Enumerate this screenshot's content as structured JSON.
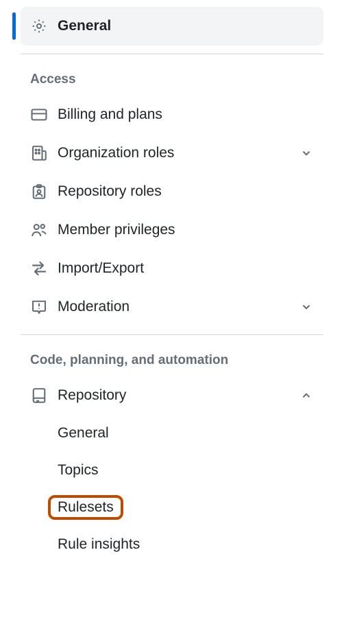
{
  "general": {
    "label": "General"
  },
  "sections": {
    "access": {
      "title": "Access",
      "items": {
        "billing": {
          "label": "Billing and plans"
        },
        "org_roles": {
          "label": "Organization roles"
        },
        "repo_roles": {
          "label": "Repository roles"
        },
        "member_priv": {
          "label": "Member privileges"
        },
        "import_export": {
          "label": "Import/Export"
        },
        "moderation": {
          "label": "Moderation"
        }
      }
    },
    "code": {
      "title": "Code, planning, and automation",
      "repository": {
        "label": "Repository",
        "children": {
          "general": {
            "label": "General"
          },
          "topics": {
            "label": "Topics"
          },
          "rulesets": {
            "label": "Rulesets"
          },
          "rule_insights": {
            "label": "Rule insights"
          }
        }
      }
    }
  }
}
